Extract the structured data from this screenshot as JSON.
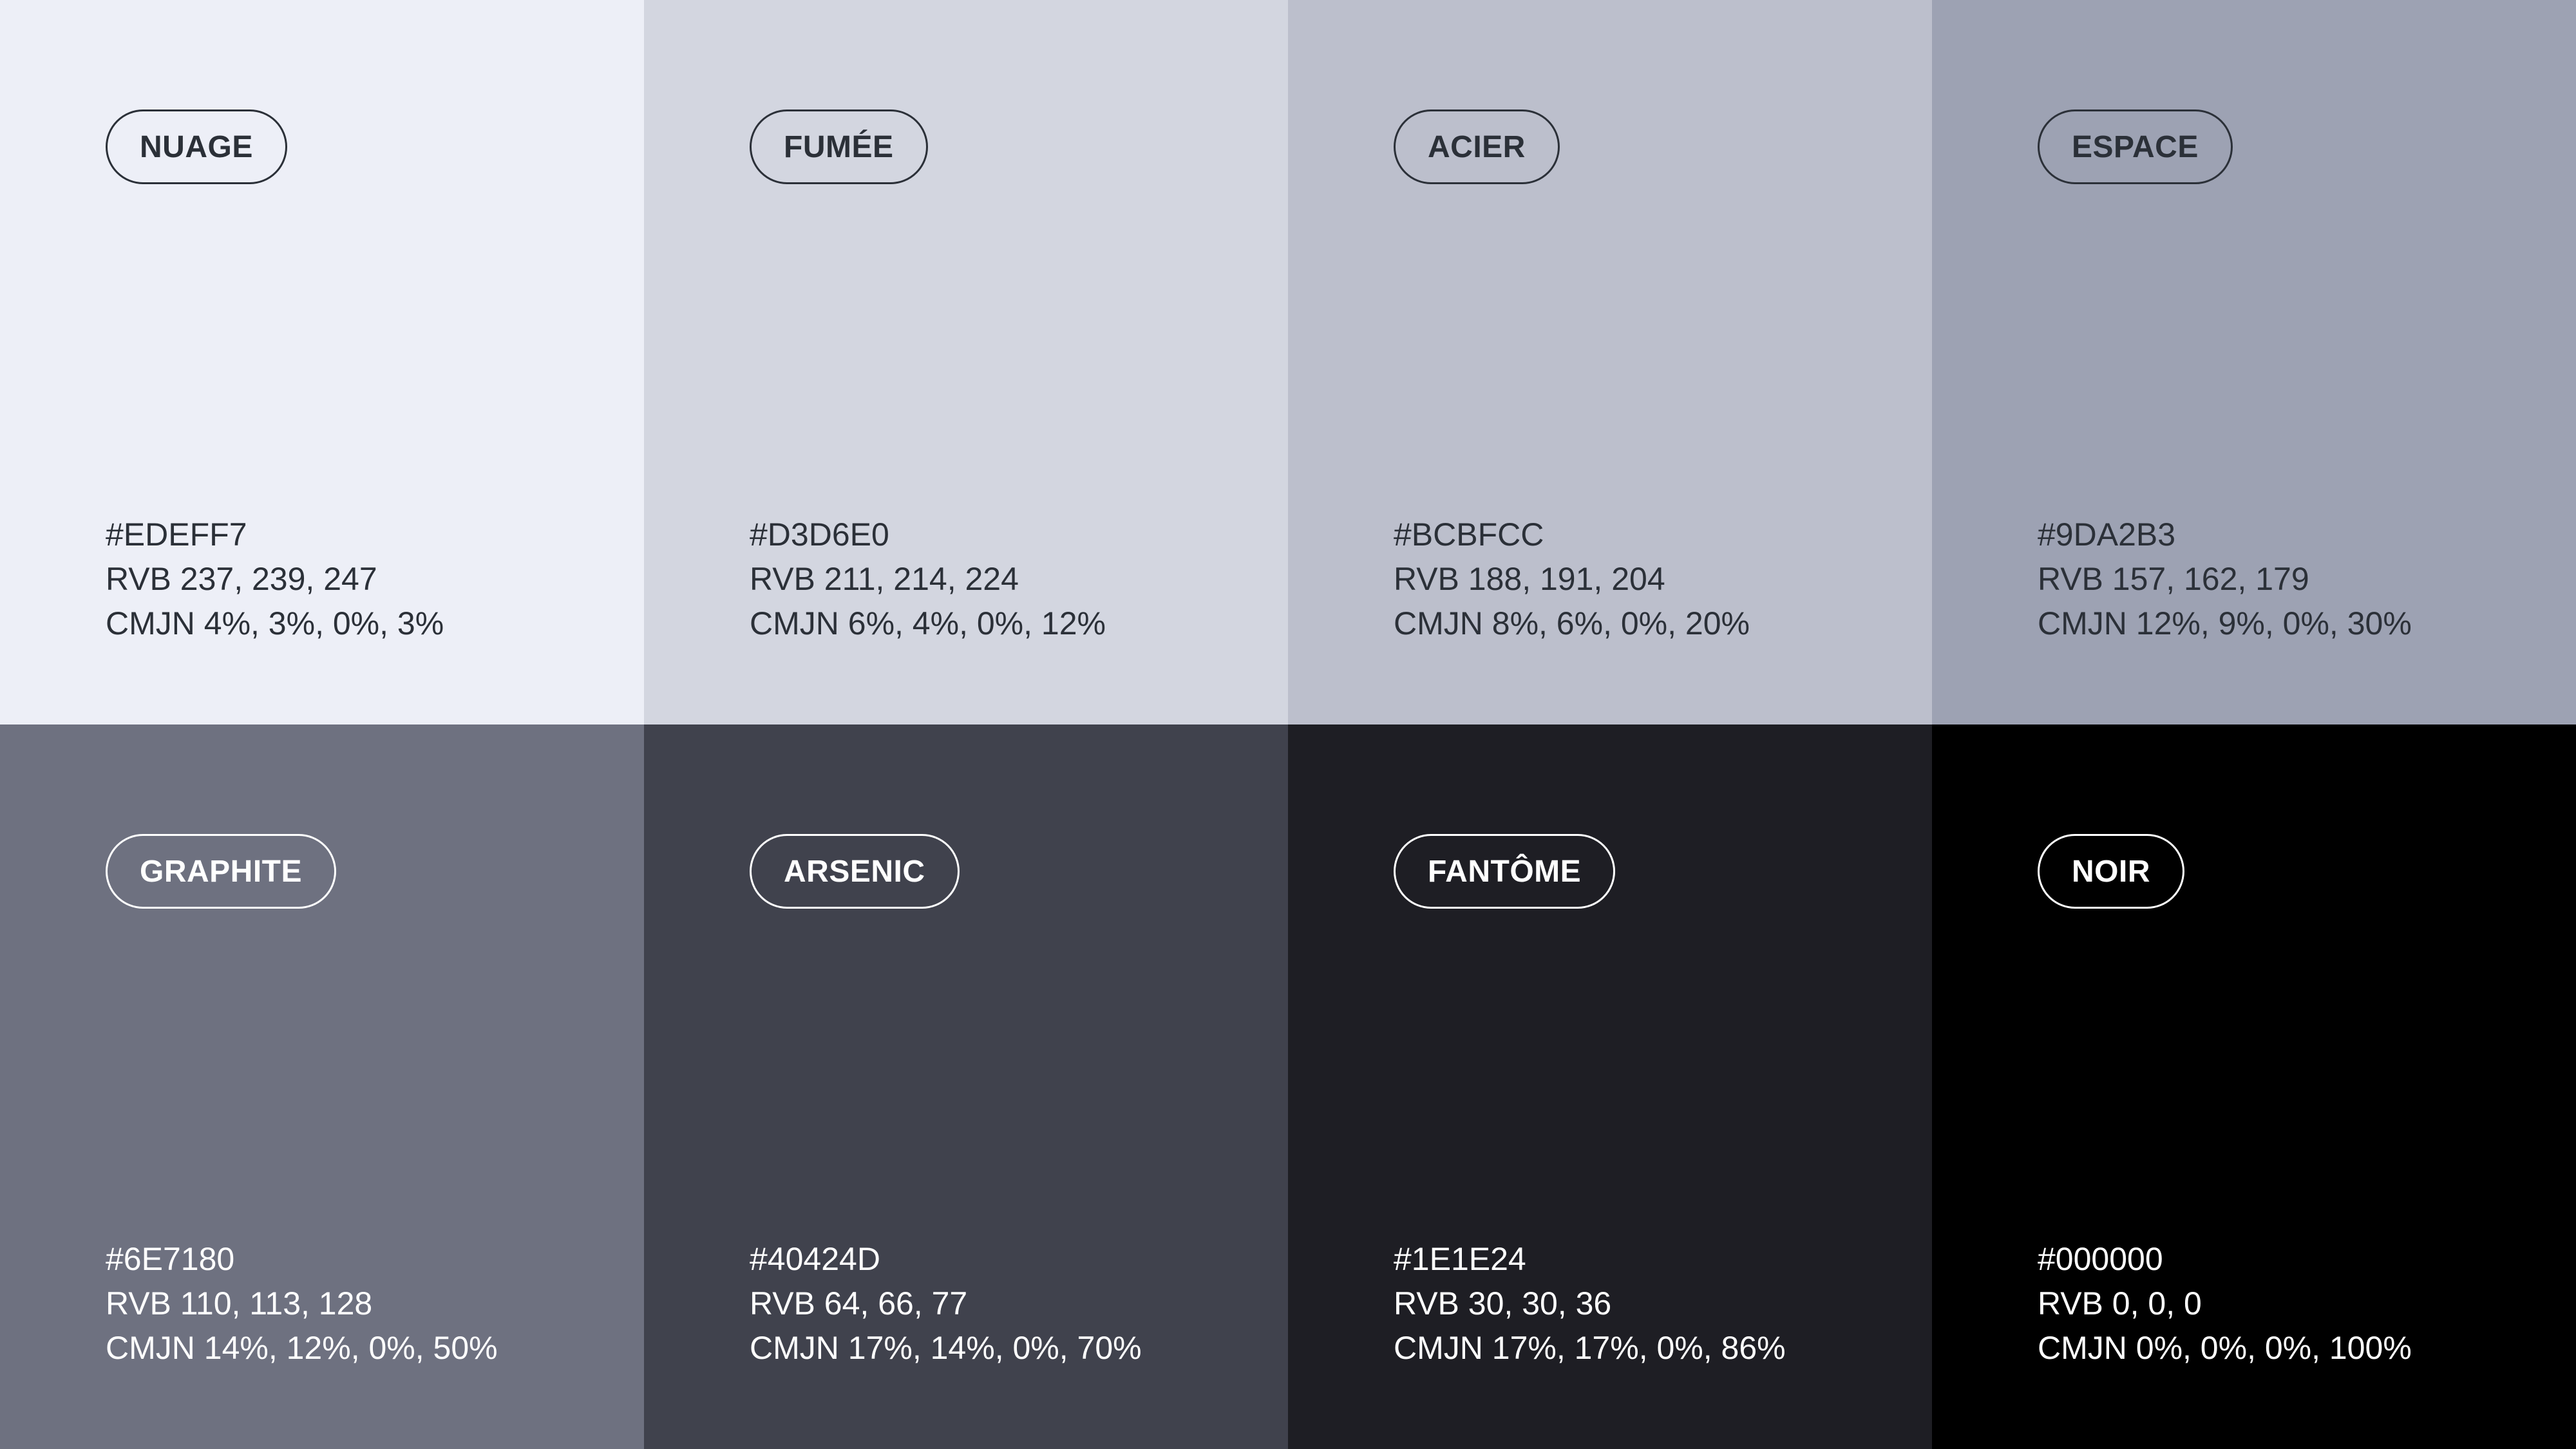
{
  "swatches": [
    {
      "name": "NUAGE",
      "hex": "#EDEFF7",
      "rvb": "RVB 237, 239, 247",
      "cmjn": "CMJN 4%, 3%, 0%, 3%",
      "color": "#EDEFF7",
      "text_color": "#2B3038"
    },
    {
      "name": "FUMÉE",
      "hex": "#D3D6E0",
      "rvb": "RVB 211, 214, 224",
      "cmjn": "CMJN 6%, 4%, 0%, 12%",
      "color": "#D3D6E0",
      "text_color": "#2B3038"
    },
    {
      "name": "ACIER",
      "hex": "#BCBFCC",
      "rvb": "RVB 188, 191, 204",
      "cmjn": "CMJN 8%, 6%, 0%, 20%",
      "color": "#BCBFCC",
      "text_color": "#2B3038"
    },
    {
      "name": "ESPACE",
      "hex": "#9DA2B3",
      "rvb": "RVB 157, 162, 179",
      "cmjn": "CMJN 12%, 9%, 0%, 30%",
      "color": "#9DA2B3",
      "text_color": "#2B3038"
    },
    {
      "name": "GRAPHITE",
      "hex": "#6E7180",
      "rvb": "RVB 110, 113, 128",
      "cmjn": "CMJN 14%, 12%, 0%, 50%",
      "color": "#6E7180",
      "text_color": "#FFFFFF"
    },
    {
      "name": "ARSENIC",
      "hex": "#40424D",
      "rvb": "RVB 64, 66, 77",
      "cmjn": "CMJN 17%, 14%, 0%, 70%",
      "color": "#40424D",
      "text_color": "#FFFFFF"
    },
    {
      "name": "FANTÔME",
      "hex": "#1E1E24",
      "rvb": "RVB 30, 30, 36",
      "cmjn": "CMJN 17%, 17%, 0%, 86%",
      "color": "#1E1E24",
      "text_color": "#FFFFFF"
    },
    {
      "name": "NOIR",
      "hex": "#000000",
      "rvb": "RVB 0, 0, 0",
      "cmjn": "CMJN 0%, 0%, 0%, 100%",
      "color": "#000000",
      "text_color": "#FFFFFF"
    }
  ]
}
